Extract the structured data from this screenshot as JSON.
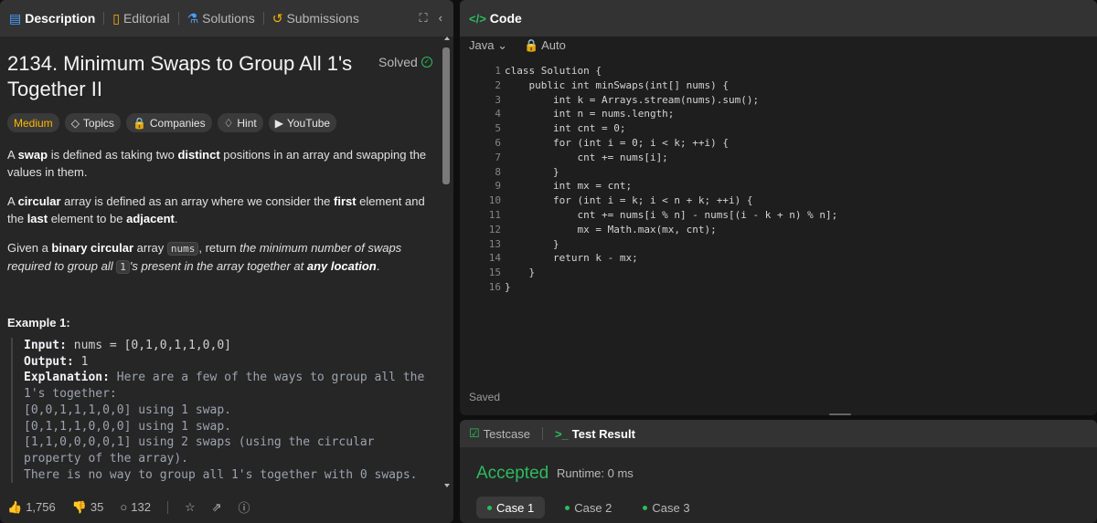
{
  "tabs": [
    {
      "label": "Description",
      "icon": "document-icon"
    },
    {
      "label": "Editorial",
      "icon": "book-icon"
    },
    {
      "label": "Solutions",
      "icon": "flask-icon"
    },
    {
      "label": "Submissions",
      "icon": "history-icon"
    }
  ],
  "problem": {
    "title": "2134. Minimum Swaps to Group All 1's Together II",
    "status": "Solved",
    "difficulty": "Medium",
    "tags": [
      "Topics",
      "Companies",
      "Hint",
      "YouTube"
    ],
    "p1_a": "A ",
    "p1_b": "swap",
    "p1_c": " is defined as taking two ",
    "p1_d": "distinct",
    "p1_e": " positions in an array and swapping the values in them.",
    "p2_a": "A ",
    "p2_b": "circular",
    "p2_c": " array is defined as an array where we consider the ",
    "p2_d": "first",
    "p2_e": " element and the ",
    "p2_f": "last",
    "p2_g": " element to be ",
    "p2_h": "adjacent",
    "p2_i": ".",
    "p3_a": "Given a ",
    "p3_b": "binary circular",
    "p3_c": " array ",
    "p3_d": "nums",
    "p3_e": ", return ",
    "p3_f": "the minimum number of swaps required to group all ",
    "p3_g": "1",
    "p3_h": "'s present in the array together at ",
    "p3_i": "any location",
    "p3_j": "."
  },
  "example": {
    "title": "Example 1:",
    "input_label": "Input:",
    "input_value": " nums = [0,1,0,1,1,0,0]",
    "output_label": "Output:",
    "output_value": " 1",
    "explanation_label": "Explanation:",
    "explanation_text": " Here are a few of the ways to group all the 1's together:\n[0,0,1,1,1,0,0] using 1 swap.\n[0,1,1,1,0,0,0] using 1 swap.\n[1,1,0,0,0,0,1] using 2 swaps (using the circular property of the array).\nThere is no way to group all 1's together with 0 swaps."
  },
  "stats": {
    "likes": "1,756",
    "dislikes": "35",
    "comments": "132"
  },
  "editor": {
    "header": "Code",
    "language": "Java",
    "mode": "Auto",
    "line_numbers": [
      "1",
      "2",
      "3",
      "4",
      "5",
      "6",
      "7",
      "8",
      "9",
      "10",
      "11",
      "12",
      "13",
      "14",
      "15",
      "16"
    ],
    "lines": [
      "class Solution {",
      "    public int minSwaps(int[] nums) {",
      "        int k = Arrays.stream(nums).sum();",
      "        int n = nums.length;",
      "        int cnt = 0;",
      "        for (int i = 0; i < k; ++i) {",
      "            cnt += nums[i];",
      "        }",
      "        int mx = cnt;",
      "        for (int i = k; i < n + k; ++i) {",
      "            cnt += nums[i % n] - nums[(i - k + n) % n];",
      "            mx = Math.max(mx, cnt);",
      "        }",
      "        return k - mx;",
      "    }",
      "}"
    ],
    "saved": "Saved"
  },
  "result": {
    "tab_testcase": "Testcase",
    "tab_result": "Test Result",
    "verdict": "Accepted",
    "runtime": "Runtime: 0 ms",
    "cases": [
      "Case 1",
      "Case 2",
      "Case 3"
    ],
    "accent": "#2cbb5d"
  }
}
